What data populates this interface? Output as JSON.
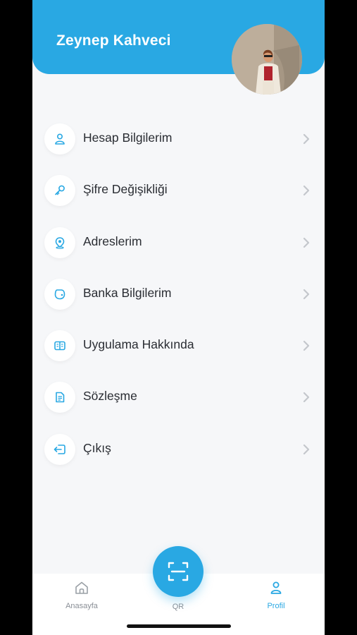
{
  "header": {
    "user_name": "Zeynep Kahveci"
  },
  "menu": {
    "items": [
      {
        "label": "Hesap Bilgilerim",
        "icon": "user-icon"
      },
      {
        "label": "Şifre Değişikliği",
        "icon": "key-icon"
      },
      {
        "label": "Adreslerim",
        "icon": "location-icon"
      },
      {
        "label": "Banka Bilgilerim",
        "icon": "wallet-icon"
      },
      {
        "label": "Uygulama Hakkında",
        "icon": "book-icon"
      },
      {
        "label": "Sözleşme",
        "icon": "document-icon"
      },
      {
        "label": "Çıkış",
        "icon": "logout-icon"
      }
    ]
  },
  "tabs": {
    "home": "Anasayfa",
    "qr": "QR",
    "profile": "Profil",
    "active": "profile"
  },
  "colors": {
    "accent": "#29a8e3",
    "background": "#f6f7f9",
    "text": "#2a2d33",
    "inactive": "#8a8f96"
  }
}
